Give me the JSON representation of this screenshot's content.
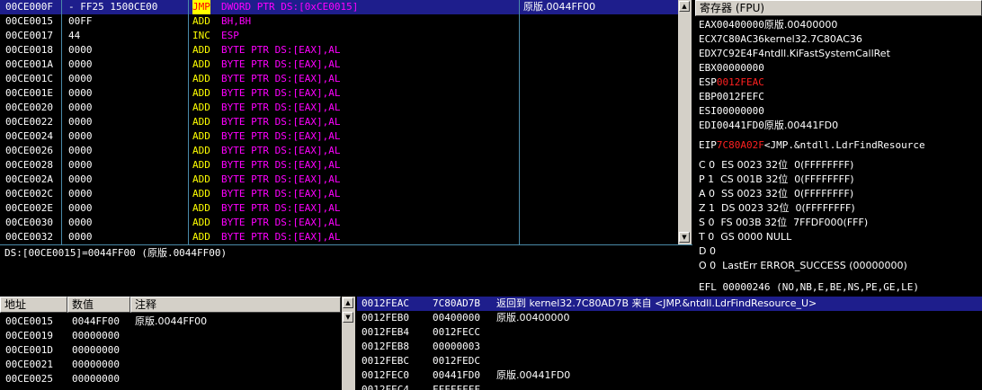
{
  "disasm": {
    "rows": [
      {
        "addr": "00CE000F",
        "hex": "- FF25 1500CE00",
        "mn": "JMP",
        "ops": "DWORD PTR DS:[0xCE0015]",
        "cmt": "原版.0044FF00"
      },
      {
        "addr": "00CE0015",
        "hex": "00FF",
        "mn": "ADD",
        "ops": "BH,BH",
        "cmt": ""
      },
      {
        "addr": "00CE0017",
        "hex": "44",
        "mn": "INC",
        "ops": "ESP",
        "cmt": ""
      },
      {
        "addr": "00CE0018",
        "hex": "0000",
        "mn": "ADD",
        "ops": "BYTE PTR DS:[EAX],AL",
        "cmt": ""
      },
      {
        "addr": "00CE001A",
        "hex": "0000",
        "mn": "ADD",
        "ops": "BYTE PTR DS:[EAX],AL",
        "cmt": ""
      },
      {
        "addr": "00CE001C",
        "hex": "0000",
        "mn": "ADD",
        "ops": "BYTE PTR DS:[EAX],AL",
        "cmt": ""
      },
      {
        "addr": "00CE001E",
        "hex": "0000",
        "mn": "ADD",
        "ops": "BYTE PTR DS:[EAX],AL",
        "cmt": ""
      },
      {
        "addr": "00CE0020",
        "hex": "0000",
        "mn": "ADD",
        "ops": "BYTE PTR DS:[EAX],AL",
        "cmt": ""
      },
      {
        "addr": "00CE0022",
        "hex": "0000",
        "mn": "ADD",
        "ops": "BYTE PTR DS:[EAX],AL",
        "cmt": ""
      },
      {
        "addr": "00CE0024",
        "hex": "0000",
        "mn": "ADD",
        "ops": "BYTE PTR DS:[EAX],AL",
        "cmt": ""
      },
      {
        "addr": "00CE0026",
        "hex": "0000",
        "mn": "ADD",
        "ops": "BYTE PTR DS:[EAX],AL",
        "cmt": ""
      },
      {
        "addr": "00CE0028",
        "hex": "0000",
        "mn": "ADD",
        "ops": "BYTE PTR DS:[EAX],AL",
        "cmt": ""
      },
      {
        "addr": "00CE002A",
        "hex": "0000",
        "mn": "ADD",
        "ops": "BYTE PTR DS:[EAX],AL",
        "cmt": ""
      },
      {
        "addr": "00CE002C",
        "hex": "0000",
        "mn": "ADD",
        "ops": "BYTE PTR DS:[EAX],AL",
        "cmt": ""
      },
      {
        "addr": "00CE002E",
        "hex": "0000",
        "mn": "ADD",
        "ops": "BYTE PTR DS:[EAX],AL",
        "cmt": ""
      },
      {
        "addr": "00CE0030",
        "hex": "0000",
        "mn": "ADD",
        "ops": "BYTE PTR DS:[EAX],AL",
        "cmt": ""
      },
      {
        "addr": "00CE0032",
        "hex": "0000",
        "mn": "ADD",
        "ops": "BYTE PTR DS:[EAX],AL",
        "cmt": ""
      }
    ]
  },
  "info": {
    "text": "DS:[00CE0015]=0044FF00 (原版.0044FF00)"
  },
  "registers": {
    "title": "寄存器 (FPU)",
    "general": [
      {
        "name": "EAX",
        "value": "00400000",
        "comment": "原版.00400000",
        "highlight": false
      },
      {
        "name": "ECX",
        "value": "7C80AC36",
        "comment": "kernel32.7C80AC36",
        "highlight": false
      },
      {
        "name": "EDX",
        "value": "7C92E4F4",
        "comment": "ntdll.KiFastSystemCallRet",
        "highlight": false
      },
      {
        "name": "EBX",
        "value": "00000000",
        "comment": "",
        "highlight": false
      },
      {
        "name": "ESP",
        "value": "0012FEAC",
        "comment": "",
        "highlight": true
      },
      {
        "name": "EBP",
        "value": "0012FEFC",
        "comment": "",
        "highlight": false
      },
      {
        "name": "ESI",
        "value": "00000000",
        "comment": "",
        "highlight": false
      },
      {
        "name": "EDI",
        "value": "00441FD0",
        "comment": "原版.00441FD0",
        "highlight": false
      }
    ],
    "eip": {
      "name": "EIP",
      "value": "7C80A02F",
      "comment": "<JMP.&ntdll.LdrFindResource"
    },
    "flags": [
      {
        "text": "C 0  ES 0023 32位  0(FFFFFFFF)"
      },
      {
        "text": "P 1  CS 001B 32位  0(FFFFFFFF)"
      },
      {
        "text": "A 0  SS 0023 32位  0(FFFFFFFF)"
      },
      {
        "text": "Z 1  DS 0023 32位  0(FFFFFFFF)"
      },
      {
        "text": "S 0  FS 003B 32位  7FFDF000(FFF)"
      },
      {
        "text": "T 0  GS 0000 NULL"
      },
      {
        "text": "D 0"
      },
      {
        "text": "O 0  LastErr ERROR_SUCCESS (00000000)"
      }
    ],
    "efl": "EFL 00000246 (NO,NB,E,BE,NS,PE,GE,LE)"
  },
  "dump": {
    "headers": {
      "addr": "地址",
      "value": "数值",
      "comment": "注释"
    },
    "rows": [
      {
        "addr": "00CE0015",
        "value": "0044FF00",
        "comment": "原版.0044FF00"
      },
      {
        "addr": "00CE0019",
        "value": "00000000",
        "comment": ""
      },
      {
        "addr": "00CE001D",
        "value": "00000000",
        "comment": ""
      },
      {
        "addr": "00CE0021",
        "value": "00000000",
        "comment": ""
      },
      {
        "addr": "00CE0025",
        "value": "00000000",
        "comment": ""
      }
    ]
  },
  "stack": {
    "rows": [
      {
        "addr": "0012FEAC",
        "value": "7C80AD7B",
        "comment": "返回到 kernel32.7C80AD7B 来自 <JMP.&ntdll.LdrFindResource_U>"
      },
      {
        "addr": "0012FEB0",
        "value": "00400000",
        "comment": "原版.00400000"
      },
      {
        "addr": "0012FEB4",
        "value": "0012FECC",
        "comment": ""
      },
      {
        "addr": "0012FEB8",
        "value": "00000003",
        "comment": ""
      },
      {
        "addr": "0012FEBC",
        "value": "0012FEDC",
        "comment": ""
      },
      {
        "addr": "0012FEC0",
        "value": "00441FD0",
        "comment": "原版.00441FD0"
      },
      {
        "addr": "0012FEC4",
        "value": "FFFFFFFF",
        "comment": ""
      }
    ]
  },
  "colors": {
    "background": "#000000",
    "text": "#ffffff",
    "mnemonic": "#ffff00",
    "operand": "#ff00ff",
    "jmp_bg": "#ffff00",
    "jmp_fg": "#ff0000",
    "selection": "#1e1e8c",
    "register_changed": "#ff2020",
    "chrome": "#d4d0c8"
  }
}
